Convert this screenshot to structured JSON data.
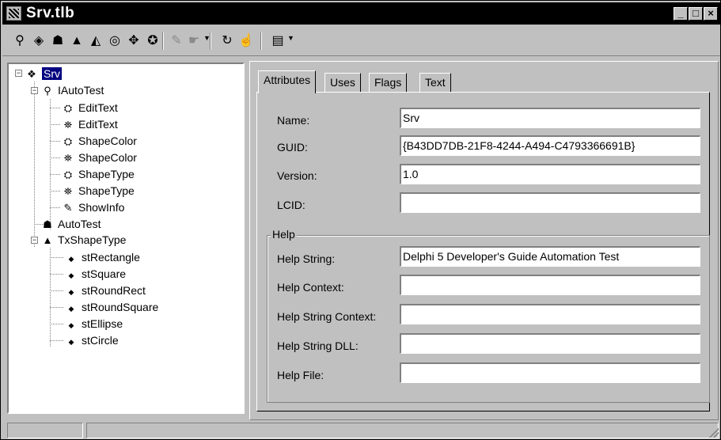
{
  "window": {
    "title": "Srv.tlb",
    "buttons": {
      "minimize": "_",
      "maximize": "□",
      "close": "×"
    }
  },
  "toolbar": {
    "buttons": [
      {
        "icon": "interface-icon",
        "glyph": "⚲",
        "enabled": true
      },
      {
        "icon": "dispinterface-icon",
        "glyph": "◈",
        "enabled": true
      },
      {
        "icon": "coclass-icon",
        "glyph": "☗",
        "enabled": true
      },
      {
        "icon": "enum-icon",
        "glyph": "▲",
        "enabled": true
      },
      {
        "icon": "alias-icon",
        "glyph": "◭",
        "enabled": true
      },
      {
        "icon": "record-icon",
        "glyph": "◎",
        "enabled": true
      },
      {
        "icon": "union-icon",
        "glyph": "✥",
        "enabled": true
      },
      {
        "icon": "module-icon",
        "glyph": "✪",
        "enabled": true
      },
      {
        "icon": "method-icon",
        "glyph": "✎",
        "enabled": false
      },
      {
        "icon": "property-icon",
        "glyph": "☛",
        "enabled": false
      },
      {
        "icon": "refresh-icon",
        "glyph": "↻",
        "enabled": true
      },
      {
        "icon": "register-icon",
        "glyph": "☝",
        "enabled": true
      },
      {
        "icon": "export-icon",
        "glyph": "▤",
        "enabled": true
      }
    ]
  },
  "tree": {
    "root": {
      "label": "Srv",
      "selected": true
    },
    "interface": {
      "label": "IAutoTest",
      "members": [
        {
          "label": "EditText",
          "icon": "property-read-icon"
        },
        {
          "label": "EditText",
          "icon": "property-write-icon"
        },
        {
          "label": "ShapeColor",
          "icon": "property-read-icon"
        },
        {
          "label": "ShapeColor",
          "icon": "property-write-icon"
        },
        {
          "label": "ShapeType",
          "icon": "property-read-icon"
        },
        {
          "label": "ShapeType",
          "icon": "property-write-icon"
        },
        {
          "label": "ShowInfo",
          "icon": "method-icon"
        }
      ]
    },
    "coclass": {
      "label": "AutoTest"
    },
    "enum": {
      "label": "TxShapeType",
      "members": [
        "stRectangle",
        "stSquare",
        "stRoundRect",
        "stRoundSquare",
        "stEllipse",
        "stCircle"
      ]
    }
  },
  "tabs": [
    "Attributes",
    "Uses",
    "Flags",
    "Text"
  ],
  "active_tab": "Attributes",
  "attributes": {
    "name_label": "Name:",
    "name_value": "Srv",
    "guid_label": "GUID:",
    "guid_value": "{B43DD7DB-21F8-4244-A494-C4793366691B}",
    "version_label": "Version:",
    "version_value": "1.0",
    "lcid_label": "LCID:",
    "lcid_value": ""
  },
  "help": {
    "group_title": "Help",
    "help_string_label": "Help String:",
    "help_string_value": "Delphi 5 Developer's Guide Automation Test",
    "help_context_label": "Help Context:",
    "help_context_value": "",
    "help_string_context_label": "Help String Context:",
    "help_string_context_value": "",
    "help_string_dll_label": "Help String DLL:",
    "help_string_dll_value": "",
    "help_file_label": "Help File:",
    "help_file_value": ""
  }
}
